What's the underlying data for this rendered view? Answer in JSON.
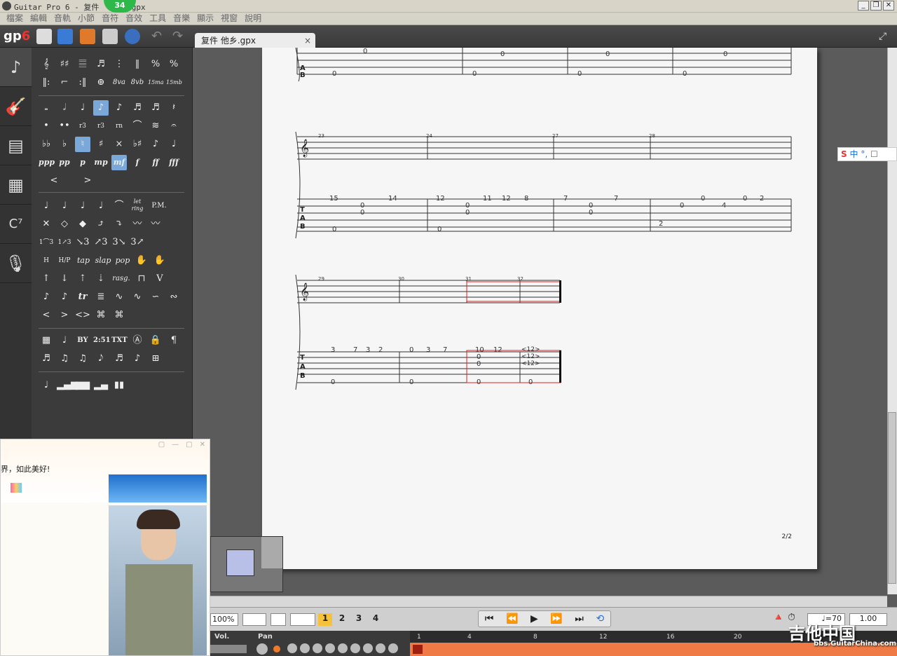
{
  "window": {
    "title": "Guitar Pro 6 - 复件 ",
    "title_suffix": "gpx",
    "badge_count": "34",
    "controls": [
      "_",
      "❐",
      "✕"
    ]
  },
  "menus": [
    "檔案",
    "編輯",
    "音軌",
    "小節",
    "音符",
    "音效",
    "工具",
    "音樂",
    "顯示",
    "視窗",
    "說明"
  ],
  "toolbar": {
    "logo": "gp",
    "logo_suffix": "6"
  },
  "doc_tab": {
    "label": "复件 他乡.gpx",
    "close": "×"
  },
  "palette": {
    "row1": [
      "𝄞",
      "♯♯",
      "𝄚",
      "♬",
      "⋮",
      "‖",
      "%",
      "%"
    ],
    "row2": [
      "‖:",
      "⌐",
      ":‖",
      "⊕",
      "8va",
      "8vb",
      "15ma",
      "15mb"
    ],
    "durations": [
      "𝅝",
      "𝅗𝅥",
      "♩",
      "♪",
      "♪",
      "♬",
      "♬",
      "𝄽"
    ],
    "dynamics": [
      "ppp",
      "pp",
      "p",
      "mp",
      "mf",
      "f",
      "ff",
      "fff"
    ],
    "text_tools": [
      "BY",
      "2:51",
      "TXT"
    ],
    "effects": [
      "let ring",
      "P.M.",
      "tap",
      "slap",
      "pop",
      "rasg.",
      "tr"
    ]
  },
  "score": {
    "page_number": "2/2",
    "bar_numbers": [
      "23",
      "24",
      "27",
      "28",
      "29",
      "30",
      "31",
      "32"
    ],
    "tab_top": [
      "0",
      "0",
      "0",
      "0",
      "0",
      "0",
      "0",
      "0"
    ],
    "tab_sys2": [
      "15",
      "14",
      "12",
      "11",
      "12",
      "8",
      "7",
      "7",
      "0",
      "0",
      "4",
      "0",
      "2",
      "0",
      "0",
      "0",
      "0",
      "0",
      "0",
      "0",
      "0",
      "2"
    ],
    "tab_sys3": [
      "3",
      "7",
      "3",
      "2",
      "0",
      "3",
      "7",
      "10",
      "12",
      "0",
      "0",
      "0",
      "<12>",
      "<12>",
      "<12>",
      "0",
      "0",
      "0"
    ]
  },
  "transport": {
    "zoom": "100%",
    "voices": [
      "1",
      "2",
      "3",
      "4"
    ],
    "tempo": "70",
    "speed": "1.00"
  },
  "tracks": {
    "vol_label": "Vol.",
    "pan_label": "Pan",
    "ruler": [
      "1",
      "4",
      "8",
      "12",
      "16",
      "20"
    ]
  },
  "chat": {
    "message": "界，如此美好!"
  },
  "ime": {
    "label": "中"
  },
  "watermark": {
    "brand": "吉他中国",
    "url": "bbs.GuitarChina.com"
  }
}
